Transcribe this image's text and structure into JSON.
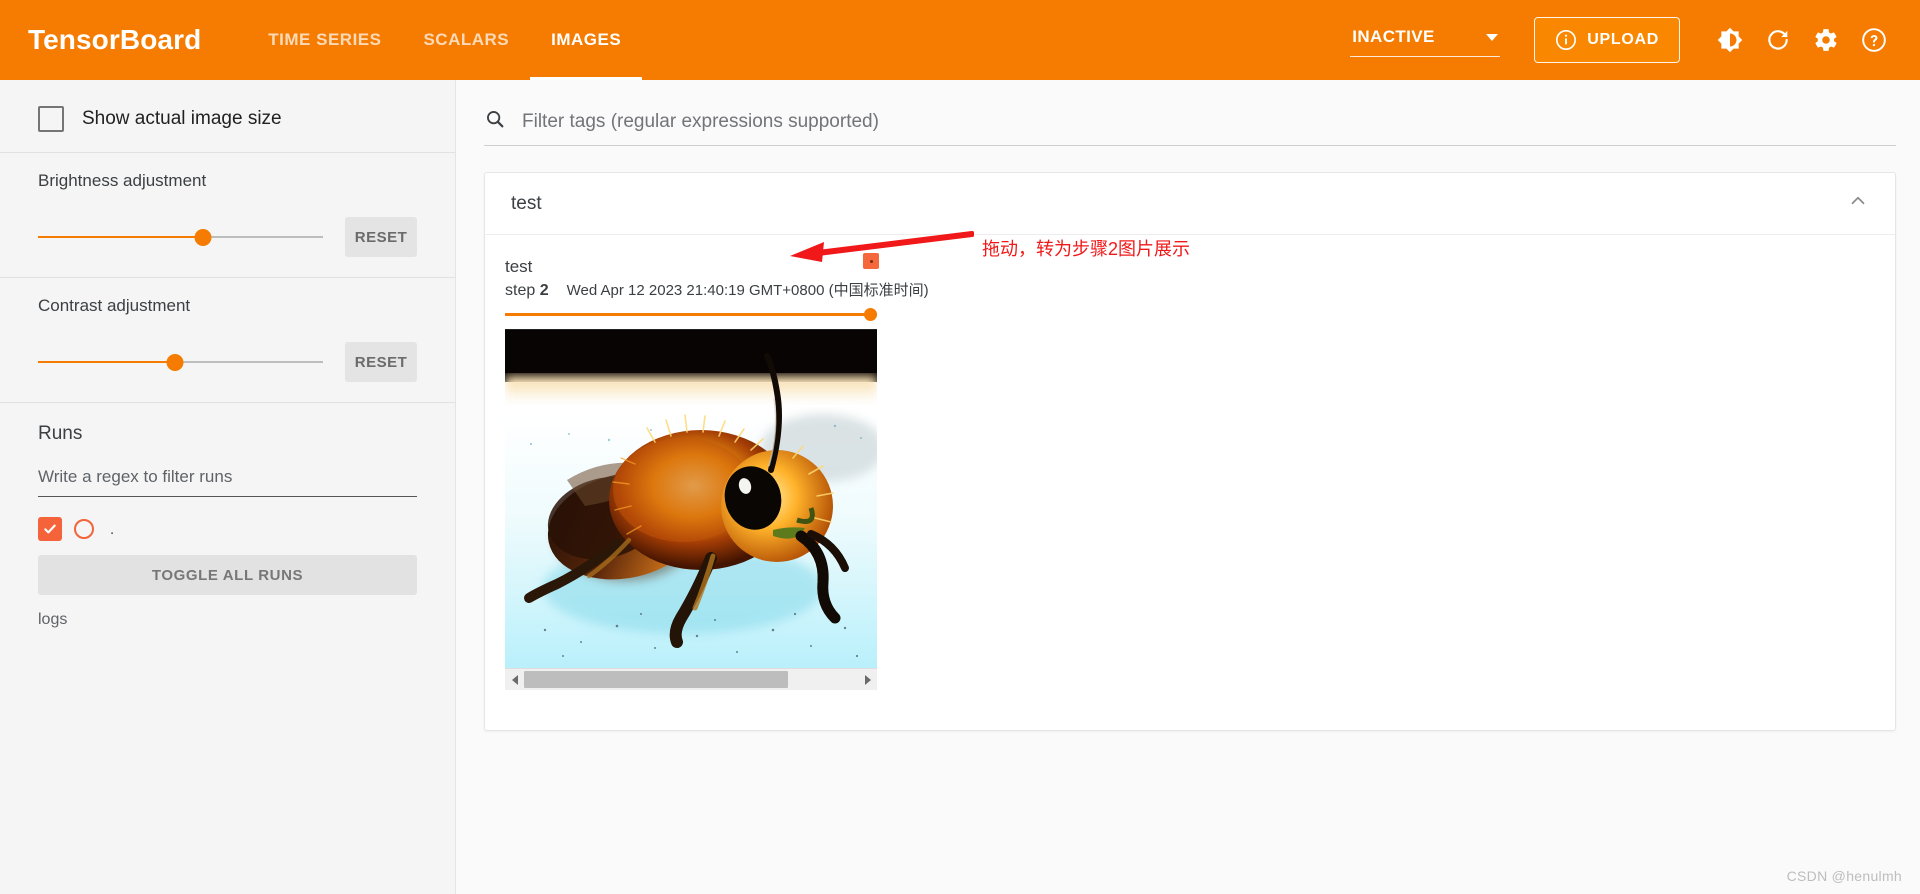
{
  "app": {
    "brand": "TensorBoard",
    "watermark": "CSDN @henulmh"
  },
  "topbar": {
    "tabs": [
      {
        "label": "TIME SERIES",
        "active": false
      },
      {
        "label": "SCALARS",
        "active": false
      },
      {
        "label": "IMAGES",
        "active": true
      }
    ],
    "run_selector": {
      "value": "INACTIVE",
      "icon": "chevron-down-icon"
    },
    "upload_button": {
      "label": "UPLOAD",
      "icon": "info-circle-icon"
    },
    "icons": [
      {
        "name": "brightness-icon",
        "title": "Toggle dark mode"
      },
      {
        "name": "refresh-icon",
        "title": "Refresh"
      },
      {
        "name": "settings-gear-icon",
        "title": "Settings"
      },
      {
        "name": "help-circle-icon",
        "title": "Help"
      }
    ]
  },
  "sidebar": {
    "show_actual_size": {
      "label": "Show actual image size",
      "checked": false
    },
    "brightness": {
      "label": "Brightness adjustment",
      "reset_label": "RESET",
      "value_percent": 58
    },
    "contrast": {
      "label": "Contrast adjustment",
      "reset_label": "RESET",
      "value_percent": 48
    },
    "runs": {
      "title": "Runs",
      "filter_placeholder": "Write a regex to filter runs",
      "filter_value": "",
      "items": [
        {
          "label": ".",
          "checked": true
        }
      ],
      "toggle_all_label": "TOGGLE ALL RUNS",
      "logs_label": "logs"
    }
  },
  "content": {
    "tag_filter": {
      "placeholder": "Filter tags (regular expressions supported)",
      "value": "",
      "icon": "search-icon"
    },
    "card": {
      "title": "test",
      "collapse_icon": "chevron-up-icon",
      "tile": {
        "name": "test",
        "step_label": "step",
        "step_value": "2",
        "timestamp": "Wed Apr 12 2023 21:40:19 GMT+0800 (中国标准时间)",
        "slider_percent": 100,
        "scroll_thumb_percent": 79
      }
    },
    "annotation": {
      "text": "拖动，转为步骤2图片展示",
      "color": "#f01818"
    }
  },
  "colors": {
    "brand_orange": "#f57c00",
    "accent_orange": "#f98700",
    "run_checkbox": "#f4633a",
    "annotation_red": "#f01818"
  }
}
